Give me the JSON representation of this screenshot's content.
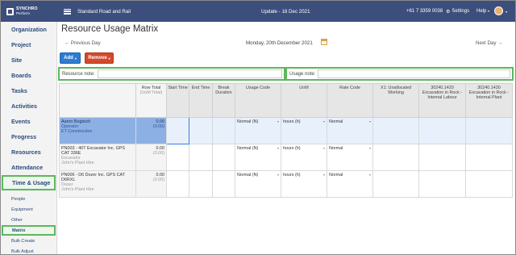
{
  "topbar": {
    "logo_line1": "SYNCHRO",
    "logo_line2": "Perform",
    "project": "Standard Road and Rail",
    "update": "Update - 18 Dec 2021",
    "phone": "+61 7 3359 0038",
    "settings": "Settings",
    "help": "Help"
  },
  "sidebar": {
    "items": [
      {
        "label": "Organization"
      },
      {
        "label": "Project"
      },
      {
        "label": "Site"
      },
      {
        "label": "Boards"
      },
      {
        "label": "Tasks"
      },
      {
        "label": "Activities"
      },
      {
        "label": "Events"
      },
      {
        "label": "Progress"
      },
      {
        "label": "Resources"
      },
      {
        "label": "Attendance"
      },
      {
        "label": "Time & Usage"
      }
    ],
    "subitems": [
      {
        "label": "People"
      },
      {
        "label": "Equipment"
      },
      {
        "label": "Other"
      },
      {
        "label": "Matrix"
      },
      {
        "label": "Bulk Create"
      },
      {
        "label": "Bulk Adjust"
      }
    ]
  },
  "main": {
    "title": "Resource Usage Matrix",
    "prev": "← Previous Day",
    "date": "Monday, 20th December 2021",
    "next": "Next Day →",
    "add": "Add",
    "remove": "Remove",
    "resource_note": "Resource note:",
    "usage_note": "Usage note:"
  },
  "table": {
    "headers": {
      "total": "Row Total",
      "total_unit": "(UoM Total)",
      "start": "Start Time",
      "end": "End Time",
      "break": "Break Duration",
      "usage": "Usage Code",
      "uom": "UoM",
      "rate": "Rate Code",
      "x1": "X1: Unallocated Working",
      "c1": "30240.1420 Excavation in Rock - Internal Labour",
      "c2": "30240.1430 Excavation in Rock - Internal Plant"
    },
    "rows": [
      {
        "name": "Aaron Bogisich",
        "role": "Operator",
        "org": "ET Construction",
        "total": "0.00",
        "uom_total": "(0.00)",
        "usage": "Normal (N)",
        "uom": "hours (h)",
        "rate": "Normal"
      },
      {
        "name": "PN003 - 40T Excavator Inc. GPS CAT 336E",
        "role": "Excavator",
        "org": "John's Plant Hire",
        "total": "0.00",
        "uom_total": "(0.00)",
        "usage": "Normal (N)",
        "uom": "hours (h)",
        "rate": "Normal"
      },
      {
        "name": "PN006 - D6 Dozer Inc. GPS CAT D6RXL",
        "role": "Dozer",
        "org": "John's Plant Hire",
        "total": "0.00",
        "uom_total": "(0.00)",
        "usage": "Normal (N)",
        "uom": "hours (h)",
        "rate": "Normal"
      }
    ]
  }
}
